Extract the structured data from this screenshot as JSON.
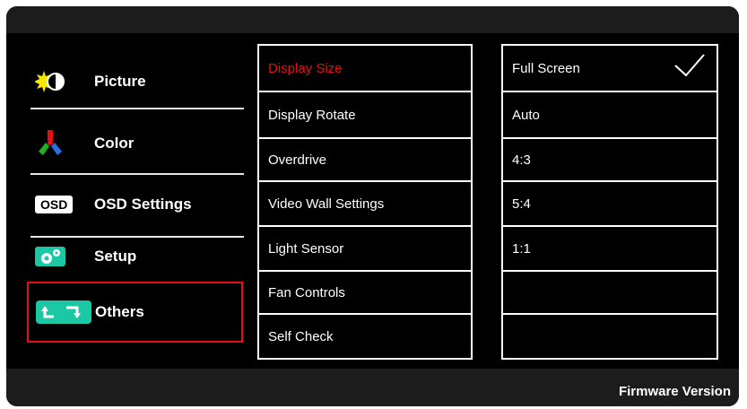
{
  "footer": {
    "firmware_label": "Firmware Version"
  },
  "sidebar": {
    "items": [
      {
        "label": "Picture",
        "icon": "brightness-contrast-icon"
      },
      {
        "label": "Color",
        "icon": "color-wheel-icon"
      },
      {
        "label": "OSD Settings",
        "icon": "osd-badge-icon",
        "badge": "OSD"
      },
      {
        "label": "Setup",
        "icon": "gear-icon"
      },
      {
        "label": "Others",
        "icon": "swap-arrows-icon",
        "selected": true
      }
    ]
  },
  "submenu": {
    "items": [
      {
        "label": "Display Size",
        "active": true
      },
      {
        "label": "Display Rotate"
      },
      {
        "label": "Overdrive"
      },
      {
        "label": "Video Wall Settings"
      },
      {
        "label": "Light Sensor"
      },
      {
        "label": "Fan Controls"
      },
      {
        "label": "Self Check"
      }
    ]
  },
  "options": {
    "items": [
      {
        "label": "Full Screen",
        "checked": true
      },
      {
        "label": "Auto"
      },
      {
        "label": "4:3"
      },
      {
        "label": "5:4"
      },
      {
        "label": "1:1"
      },
      {
        "label": ""
      },
      {
        "label": ""
      }
    ]
  },
  "colors": {
    "accent_red": "#e41010",
    "background": "#000000",
    "foreground": "#ffffff",
    "others_icon": "#1cc7a6"
  }
}
